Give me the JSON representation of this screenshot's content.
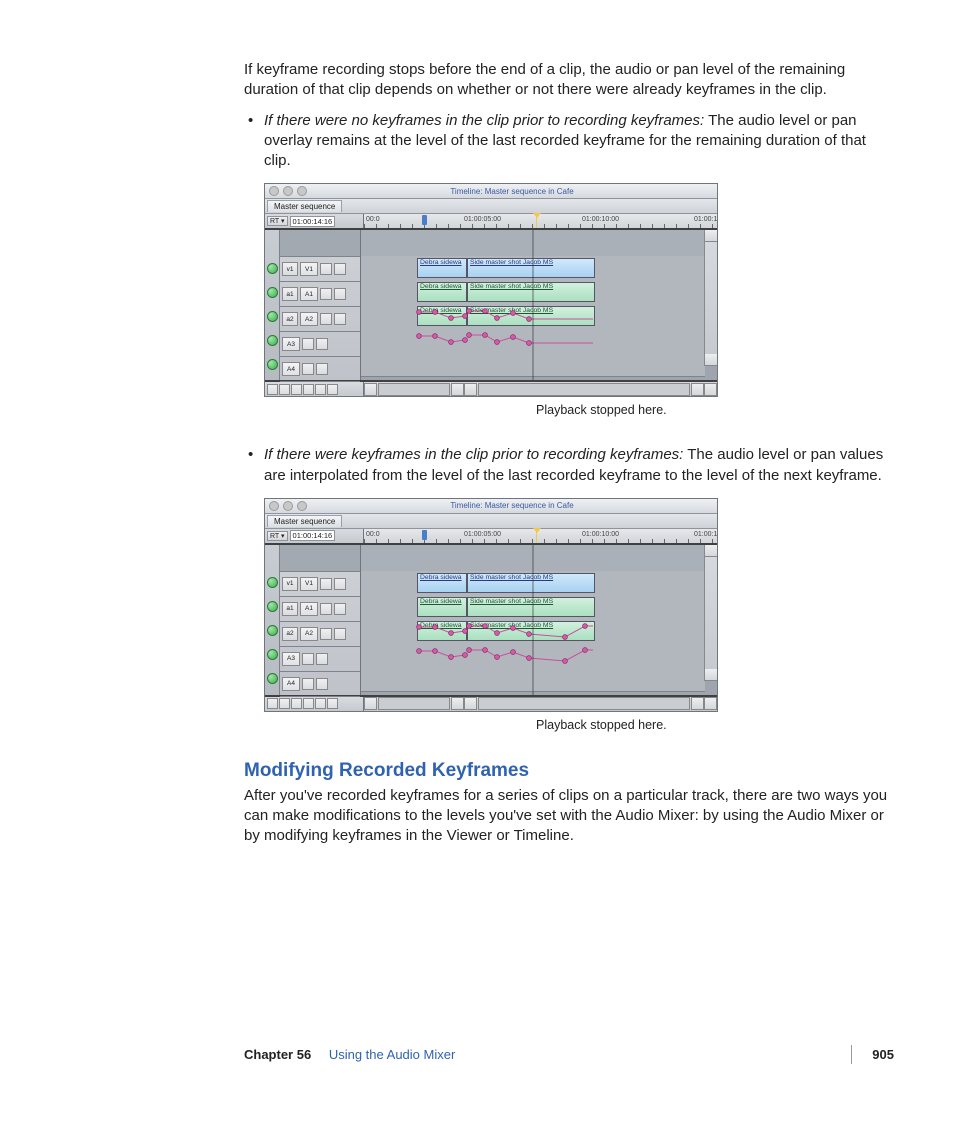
{
  "intro_para": "If keyframe recording stops before the end of a clip, the audio or pan level of the remaining duration of that clip depends on whether or not there were already keyframes in the clip.",
  "bullet1": {
    "lead_italic": "If there were no keyframes in the clip prior to recording keyframes:",
    "rest": "  The audio level or pan overlay remains at the level of the last recorded keyframe for the remaining duration of that clip."
  },
  "bullet2": {
    "lead_italic": "If there were keyframes in the clip prior to recording keyframes:",
    "rest": "  The audio level or pan values are interpolated from the level of the last recorded keyframe to the level of the next keyframe."
  },
  "caption": "Playback stopped here.",
  "heading": "Modifying Recorded Keyframes",
  "heading_para": "After you've recorded keyframes for a series of clips on a particular track, there are two ways you can make modifications to the levels you've set with the Audio Mixer: by using the Audio Mixer or by modifying keyframes in the Viewer or Timeline.",
  "footer": {
    "chapter": "Chapter 56",
    "title": "Using the Audio Mixer",
    "page": "905"
  },
  "timeline": {
    "title": "Timeline: Master sequence in Cafe",
    "tab": "Master sequence",
    "rt_label": "RT ▾",
    "timecode": "01:00:14:16",
    "ruler": [
      "00:0",
      "01:00:05:00",
      "01:00:10:00",
      "01:00:1"
    ],
    "tracks": {
      "v1_src": "v1",
      "v1_dst": "V1",
      "a1_src": "a1",
      "a1_dst": "A1",
      "a2_src": "a2",
      "a2_dst": "A2",
      "a3_dst": "A3",
      "a4_dst": "A4"
    },
    "clips": {
      "video_a": "Debra sidewa",
      "video_b": "Side master shot Jacob MS",
      "audio_a": "Debra sidewa",
      "audio_b": "Side master shot Jacob MS"
    }
  }
}
